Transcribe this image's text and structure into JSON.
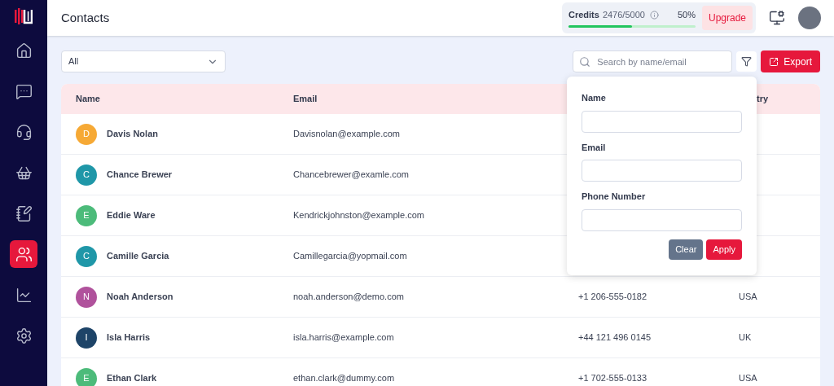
{
  "header": {
    "title": "Contacts",
    "credits": {
      "label": "Credits",
      "value": "2476/5000",
      "percent": "50%",
      "level": 0.5
    },
    "upgrade": "Upgrade"
  },
  "sidebar": {
    "items": [
      {
        "kind": "home",
        "selected": false
      },
      {
        "kind": "chat",
        "selected": false
      },
      {
        "kind": "headset",
        "selected": false
      },
      {
        "kind": "basket",
        "selected": false
      },
      {
        "kind": "notebook",
        "selected": false
      },
      {
        "kind": "users",
        "selected": true
      },
      {
        "kind": "chart",
        "selected": false
      },
      {
        "kind": "settings",
        "selected": false
      }
    ]
  },
  "toolbar": {
    "filter_select": "All",
    "search": {
      "placeholder": "Search by name/email"
    },
    "export": "Export"
  },
  "filter_popover": {
    "fields": [
      {
        "label": "Name"
      },
      {
        "label": "Email"
      },
      {
        "label": "Phone Number"
      }
    ],
    "buttons": [
      {
        "kind": "secondary",
        "label": "Clear"
      },
      {
        "kind": "primary",
        "label": "Apply"
      }
    ]
  },
  "table": {
    "columns": [
      {
        "label": "Name"
      },
      {
        "label": "Email"
      },
      {},
      {
        "label": "try"
      }
    ],
    "rows": [
      {
        "initial": "D",
        "color": "#f6a935",
        "name": "Davis Nolan",
        "email": "Davisnolan@example.com"
      },
      {
        "initial": "C",
        "color": "#1f97a8",
        "name": "Chance Brewer",
        "email": "Chancebrewer@examle.com"
      },
      {
        "initial": "E",
        "color": "#4cbb7a",
        "name": "Eddie Ware",
        "email": "Kendrickjohnston@example.com"
      },
      {
        "initial": "C",
        "color": "#1f97a8",
        "name": "Camille Garcia",
        "email": "Camillegarcia@yopmail.com"
      },
      {
        "initial": "N",
        "color": "#b0529c",
        "name": "Noah Anderson",
        "email": "noah.anderson@demo.com",
        "phone": "+1 206-555-0182",
        "country": "USA"
      },
      {
        "initial": "I",
        "color": "#1e4468",
        "name": "Isla Harris",
        "email": "isla.harris@example.com",
        "phone": "+44 121 496 0145",
        "country": "UK"
      },
      {
        "initial": "E",
        "color": "#4cbb7a",
        "name": "Ethan Clark",
        "email": "ethan.clark@dummy.com",
        "phone": "+1 702-555-0133",
        "country": "USA"
      }
    ]
  }
}
